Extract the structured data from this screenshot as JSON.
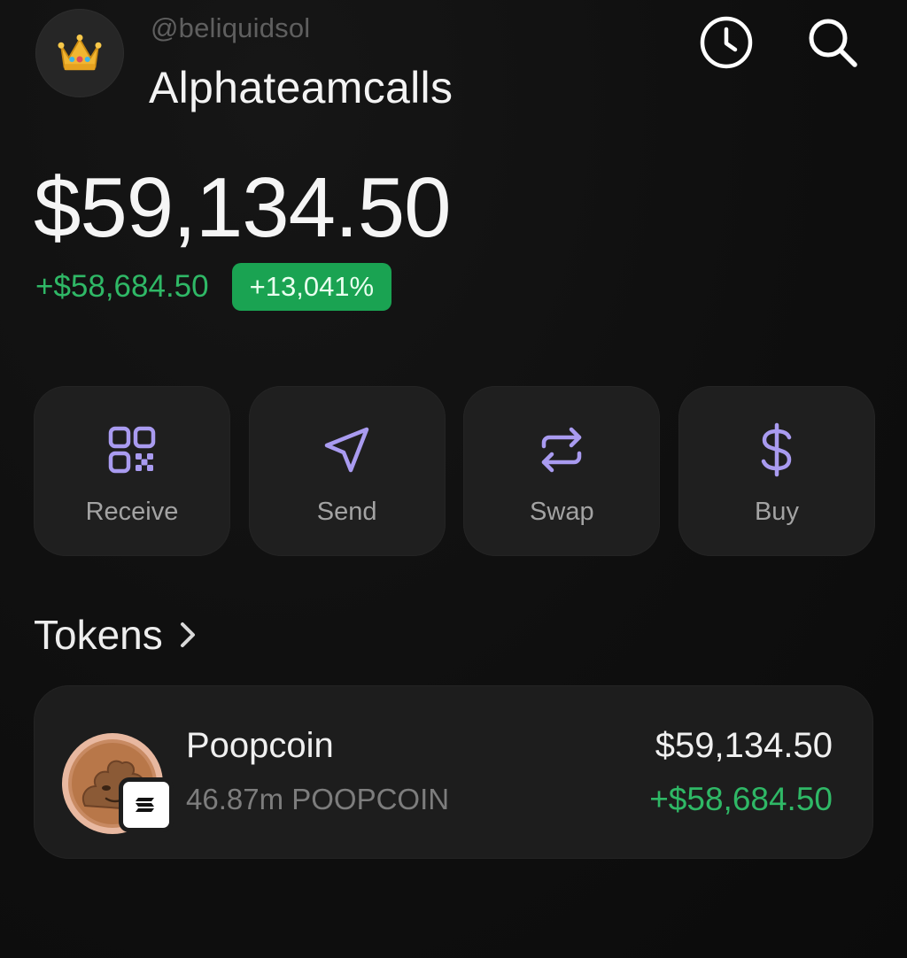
{
  "header": {
    "handle": "@beliquidsol",
    "account_name": "Alphateamcalls",
    "avatar_icon": "crown-icon",
    "history_icon": "clock-icon",
    "search_icon": "search-icon"
  },
  "balance": {
    "total": "$59,134.50",
    "change_amount": "+$58,684.50",
    "change_percent": "+13,041%"
  },
  "actions": [
    {
      "label": "Receive",
      "icon": "qr-code-icon"
    },
    {
      "label": "Send",
      "icon": "send-arrow-icon"
    },
    {
      "label": "Swap",
      "icon": "swap-arrows-icon"
    },
    {
      "label": "Buy",
      "icon": "dollar-icon"
    }
  ],
  "tokens": {
    "title": "Tokens",
    "items": [
      {
        "name": "Poopcoin",
        "amount": "46.87m POOPCOIN",
        "value": "$59,134.50",
        "change": "+$58,684.50",
        "logo_icon": "poopcoin-logo-icon",
        "chain_icon": "solana-badge-icon"
      }
    ]
  },
  "colors": {
    "background": "#0e0e0e",
    "card": "#1f1f1f",
    "accent_purple": "#a99bf0",
    "positive_green": "#2fb866",
    "badge_green": "#1aa352"
  }
}
